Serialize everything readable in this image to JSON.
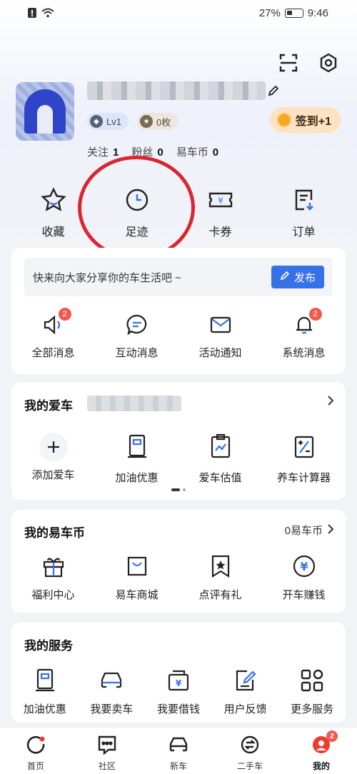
{
  "status_bar": {
    "battery": "27%",
    "time": "9:46"
  },
  "profile": {
    "level": "Lv1",
    "medal": "0枚",
    "signin_label": "签到+1",
    "stats": [
      {
        "label": "关注",
        "value": "1"
      },
      {
        "label": "粉丝",
        "value": "0"
      },
      {
        "label": "易车币",
        "value": "0"
      }
    ]
  },
  "quick_actions": [
    {
      "label": "收藏",
      "icon": "star-icon"
    },
    {
      "label": "足迹",
      "icon": "clock-icon"
    },
    {
      "label": "卡券",
      "icon": "ticket-icon"
    },
    {
      "label": "订单",
      "icon": "order-icon"
    }
  ],
  "messages_card": {
    "share_text": "快来向大家分享你的车生活吧 ~",
    "publish_label": "发布",
    "items": [
      {
        "label": "全部消息",
        "badge": "2"
      },
      {
        "label": "互动消息",
        "badge": ""
      },
      {
        "label": "活动通知",
        "badge": ""
      },
      {
        "label": "系统消息",
        "badge": "2"
      }
    ]
  },
  "my_car": {
    "title": "我的爱车",
    "items": [
      {
        "label": "添加爱车"
      },
      {
        "label": "加油优惠"
      },
      {
        "label": "爱车估值"
      },
      {
        "label": "养车计算器"
      }
    ]
  },
  "my_coins": {
    "title": "我的易车币",
    "balance": "0易车币",
    "items": [
      {
        "label": "福利中心"
      },
      {
        "label": "易车商城"
      },
      {
        "label": "点评有礼"
      },
      {
        "label": "开车赚钱"
      }
    ]
  },
  "services": {
    "title": "我的服务",
    "items": [
      {
        "label": "加油优惠"
      },
      {
        "label": "我要卖车"
      },
      {
        "label": "我要借钱"
      },
      {
        "label": "用户反馈"
      },
      {
        "label": "更多服务"
      }
    ]
  },
  "bottom_nav": {
    "items": [
      {
        "label": "首页"
      },
      {
        "label": "社区"
      },
      {
        "label": "新车"
      },
      {
        "label": "二手车"
      },
      {
        "label": "我的",
        "badge": "2"
      }
    ]
  },
  "colors": {
    "accent": "#3672e6",
    "badge_red": "#ee5a4f",
    "circle_red": "#d9262f",
    "signin_bg": "#fde3c3"
  }
}
